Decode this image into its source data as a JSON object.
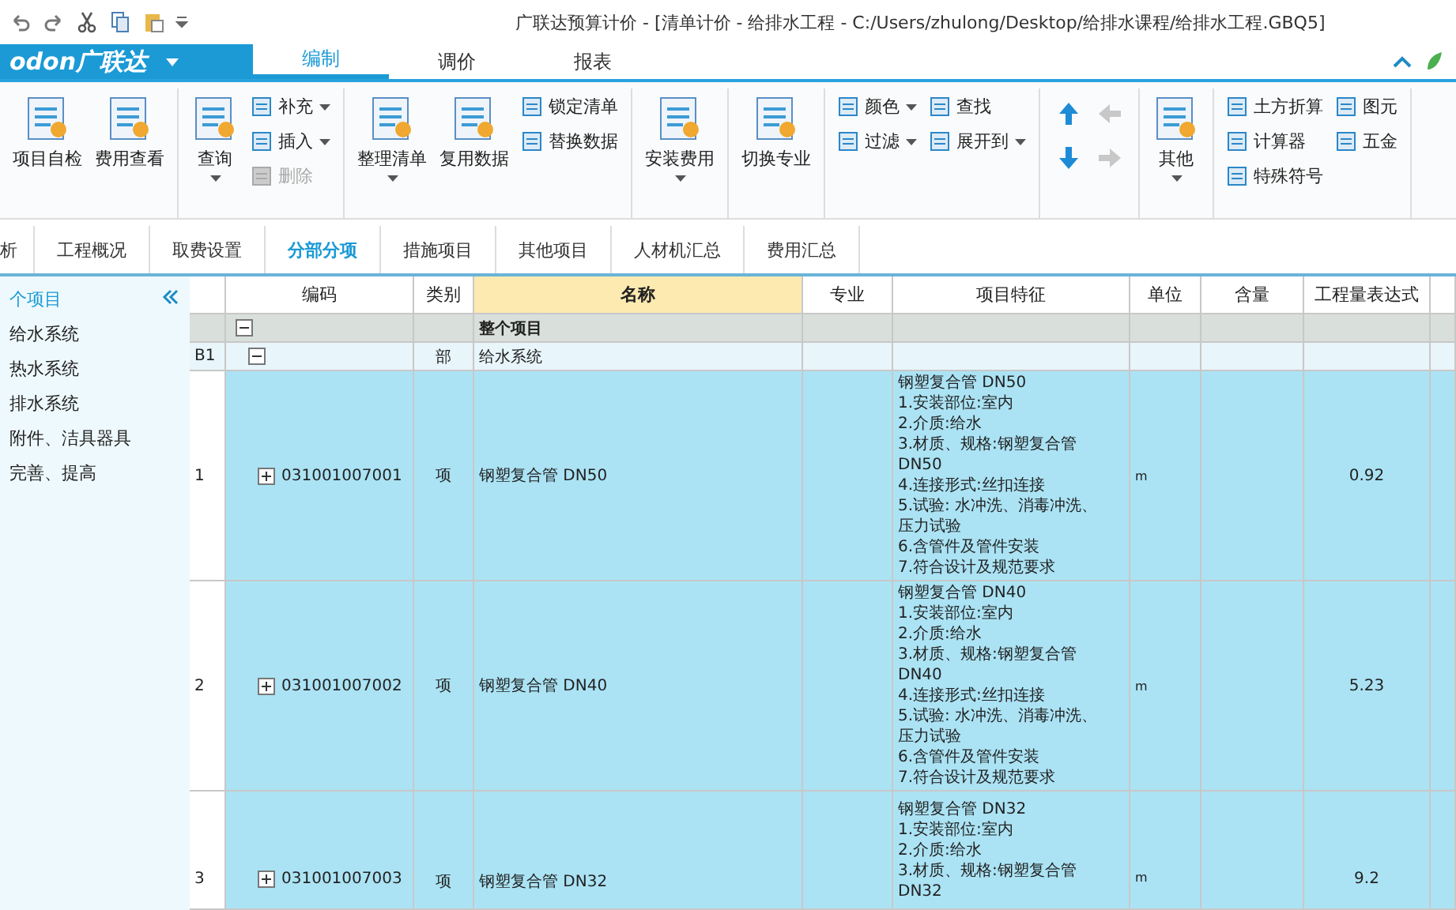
{
  "window": {
    "title": "广联达预算计价 - [清单计价 - 给排水工程 - C:/Users/zhulong/Desktop/给排水课程/给排水工程.GBQ5]"
  },
  "logo": {
    "text": "odon广联达"
  },
  "ribbon_tabs": [
    {
      "label": "编制",
      "selected": true
    },
    {
      "label": "调价",
      "selected": false
    },
    {
      "label": "报表",
      "selected": false
    }
  ],
  "ribbon_groups": [
    {
      "kind": "buttons",
      "items": [
        {
          "kind": "large",
          "label": "项目自检",
          "dropdown": false
        },
        {
          "kind": "large",
          "label": "费用查看",
          "dropdown": false
        }
      ]
    },
    {
      "kind": "buttons",
      "items": [
        {
          "kind": "large",
          "label": "查询",
          "dropdown": true
        },
        {
          "kind": "stack",
          "items": [
            {
              "label": "补充",
              "dropdown": true,
              "disabled": false
            },
            {
              "label": "插入",
              "dropdown": true,
              "disabled": false
            },
            {
              "label": "删除",
              "dropdown": false,
              "disabled": true
            }
          ]
        }
      ]
    },
    {
      "kind": "buttons",
      "items": [
        {
          "kind": "large",
          "label": "整理清单",
          "dropdown": true
        },
        {
          "kind": "large",
          "label": "复用数据",
          "dropdown": false
        },
        {
          "kind": "stack",
          "items": [
            {
              "label": "锁定清单",
              "dropdown": false,
              "disabled": false
            },
            {
              "label": "替换数据",
              "dropdown": false,
              "disabled": false
            }
          ]
        }
      ]
    },
    {
      "kind": "buttons",
      "items": [
        {
          "kind": "large",
          "label": "安装费用",
          "dropdown": true
        }
      ]
    },
    {
      "kind": "buttons",
      "items": [
        {
          "kind": "large",
          "label": "切换专业",
          "dropdown": false
        }
      ]
    },
    {
      "kind": "buttons",
      "items": [
        {
          "kind": "stack",
          "items": [
            {
              "label": "颜色",
              "dropdown": true,
              "disabled": false
            },
            {
              "label": "过滤",
              "dropdown": true,
              "disabled": false
            }
          ]
        },
        {
          "kind": "stack",
          "items": [
            {
              "label": "查找",
              "dropdown": false,
              "disabled": false
            },
            {
              "label": "展开到",
              "dropdown": true,
              "disabled": false
            }
          ]
        }
      ]
    },
    {
      "kind": "arrows",
      "items": [
        {
          "disabled": false
        },
        {
          "disabled": true
        },
        {
          "disabled": false
        },
        {
          "disabled": true
        }
      ]
    },
    {
      "kind": "buttons",
      "items": [
        {
          "kind": "large",
          "label": "其他",
          "dropdown": true
        }
      ]
    },
    {
      "kind": "buttons",
      "items": [
        {
          "kind": "stack",
          "items": [
            {
              "label": "土方折算",
              "dropdown": false,
              "disabled": false
            },
            {
              "label": "计算器",
              "dropdown": false,
              "disabled": false
            },
            {
              "label": "特殊符号",
              "dropdown": false,
              "disabled": false
            }
          ]
        },
        {
          "kind": "stack",
          "items": [
            {
              "label": "图元",
              "dropdown": false,
              "disabled": false
            },
            {
              "label": "五金",
              "dropdown": false,
              "disabled": false
            }
          ]
        }
      ]
    }
  ],
  "doc_tabs": [
    {
      "label": "析",
      "selected": false
    },
    {
      "label": "工程概况",
      "selected": false
    },
    {
      "label": "取费设置",
      "selected": false
    },
    {
      "label": "分部分项",
      "selected": true
    },
    {
      "label": "措施项目",
      "selected": false
    },
    {
      "label": "其他项目",
      "selected": false
    },
    {
      "label": "人材机汇总",
      "selected": false
    },
    {
      "label": "费用汇总",
      "selected": false
    }
  ],
  "sidebar": {
    "tree": {
      "label": "个项目",
      "selected": true,
      "children": [
        {
          "label": "给水系统",
          "selected": false
        },
        {
          "label": "热水系统",
          "selected": false
        },
        {
          "label": "排水系统",
          "selected": false
        },
        {
          "label": "附件、洁具器具",
          "selected": false
        },
        {
          "label": "完善、提高",
          "selected": false
        }
      ]
    }
  },
  "table": {
    "columns": [
      "编码",
      "类别",
      "名称",
      "专业",
      "项目特征",
      "单位",
      "含量",
      "工程量表达式"
    ],
    "rows": [
      {
        "kind": "root",
        "number": "",
        "expanded": true,
        "code": "",
        "type": "",
        "name": "整个项目",
        "features": [],
        "unit": "",
        "quantity": ""
      },
      {
        "kind": "division",
        "number": "B1",
        "expanded": true,
        "code": "",
        "type": "部",
        "name": "给水系统",
        "features": [],
        "unit": "",
        "quantity": ""
      },
      {
        "kind": "item",
        "number": "1",
        "expanded": false,
        "code": "031001007001",
        "type": "项",
        "name": "钢塑复合管 DN50",
        "features": [
          "钢塑复合管 DN50",
          "1.安装部位:室内",
          "2.介质:给水",
          "3.材质、规格:钢塑复合管",
          "DN50",
          "4.连接形式:丝扣连接",
          "5.试验: 水冲洗、消毒冲洗、",
          "压力试验",
          "6.含管件及管件安装",
          "7.符合设计及规范要求"
        ],
        "unit": "m",
        "quantity": "0.92"
      },
      {
        "kind": "item",
        "number": "2",
        "expanded": false,
        "code": "031001007002",
        "type": "项",
        "name": "钢塑复合管 DN40",
        "features": [
          "钢塑复合管 DN40",
          "1.安装部位:室内",
          "2.介质:给水",
          "3.材质、规格:钢塑复合管",
          "DN40",
          "4.连接形式:丝扣连接",
          "5.试验: 水冲洗、消毒冲洗、",
          "压力试验",
          "6.含管件及管件安装",
          "7.符合设计及规范要求"
        ],
        "unit": "m",
        "quantity": "5.23"
      },
      {
        "kind": "item",
        "number": "3",
        "expanded": false,
        "code": "031001007003",
        "type": "项",
        "name": "钢塑复合管 DN32",
        "features": [
          "钢塑复合管 DN32",
          "1.安装部位:室内",
          "2.介质:给水",
          "3.材质、规格:钢塑复合管",
          "DN32"
        ],
        "unit": "m",
        "quantity": "9.2"
      }
    ]
  }
}
